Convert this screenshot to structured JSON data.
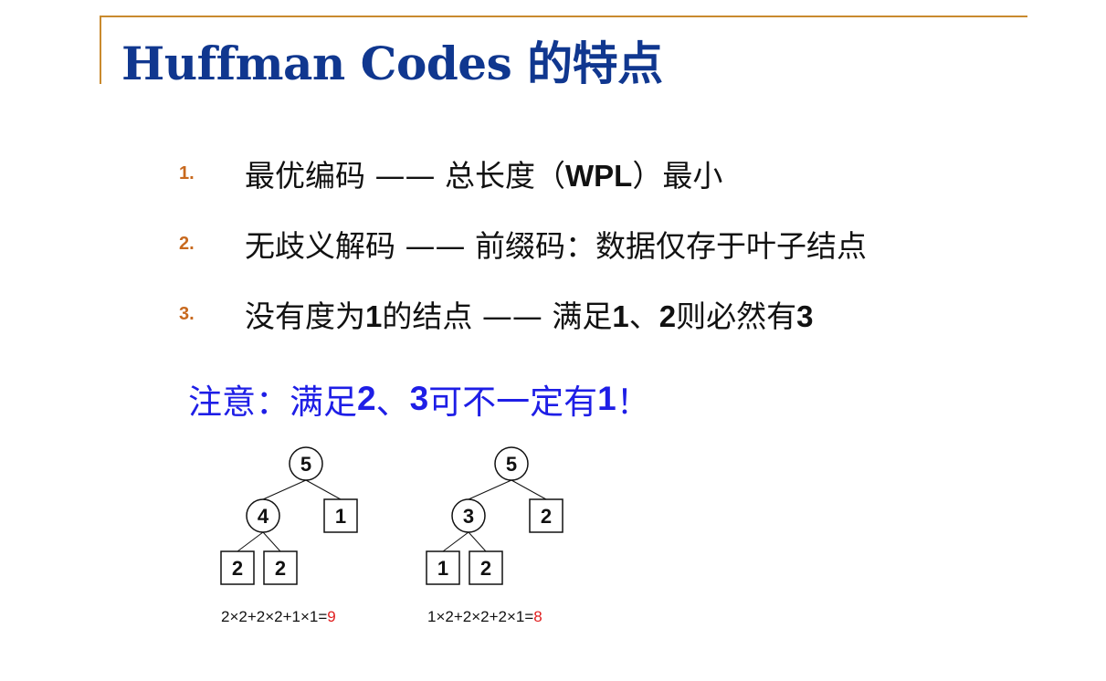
{
  "title": "Huffman Codes 的特点",
  "items": [
    {
      "num": "1.",
      "text_a": "最优编码 —— 总长度（",
      "bold": "WPL",
      "text_b": "）最小"
    },
    {
      "num": "2.",
      "text": "无歧义解码 —— 前缀码：数据仅存于叶子结点"
    },
    {
      "num": "3.",
      "p1": "没有度为",
      "b1": "1",
      "p2": "的结点 —— 满足",
      "b2": "1",
      "p3": "、",
      "b3": "2",
      "p4": "则必然有",
      "b4": "3"
    }
  ],
  "note": {
    "p1": "注意：满足",
    "b1": "2",
    "p2": "、",
    "b2": "3",
    "p3": "可不一定有",
    "b3": "1",
    "p4": "！"
  },
  "trees": [
    {
      "root": "5",
      "internal": "4",
      "leaf_right": "1",
      "leaves_bottom": [
        "2",
        "2"
      ],
      "formula": "2×2+2×2+1×1=",
      "result": "9"
    },
    {
      "root": "5",
      "internal": "3",
      "leaf_right": "2",
      "leaves_bottom": [
        "1",
        "2"
      ],
      "formula": "1×2+2×2+2×1=",
      "result": "8"
    }
  ],
  "colors": {
    "title": "#10378f",
    "frame": "#c98a2e",
    "number": "#c8691e",
    "note": "#1e1ee6",
    "result": "#e01e1e"
  }
}
